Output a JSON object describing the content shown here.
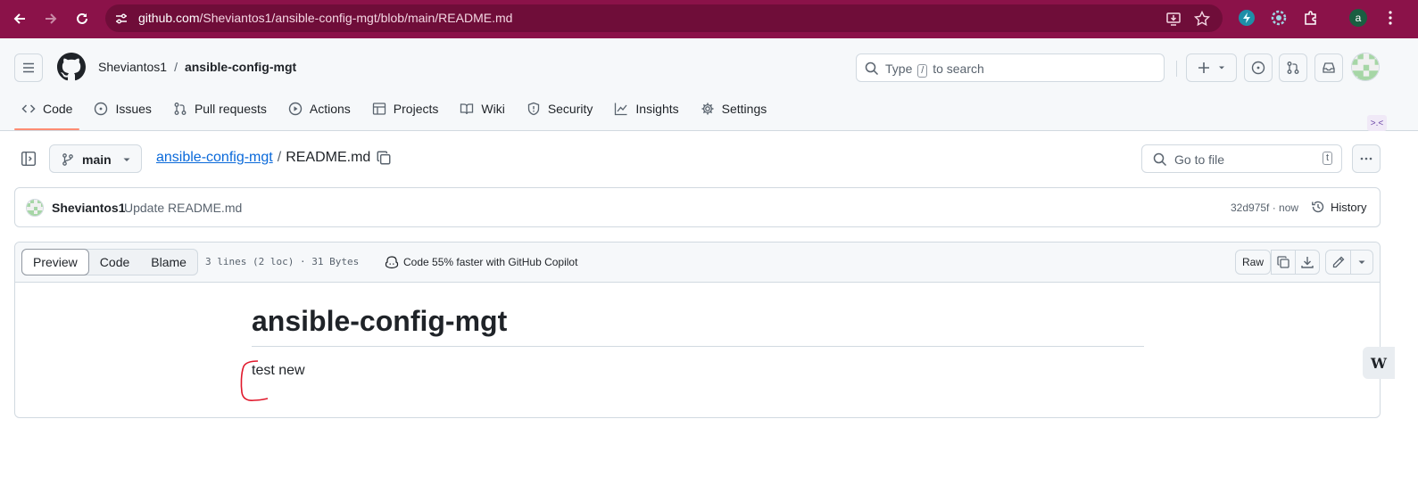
{
  "browser": {
    "url_host": "github.com",
    "url_path": "/Sheviantos1/ansible-config-mgt/blob/main/README.md",
    "profile_initial": "a",
    "chrome_color": "#8b1249"
  },
  "header": {
    "owner": "Sheviantos1",
    "separator": "/",
    "repo": "ansible-config-mgt",
    "search_prefix": "Type",
    "search_key": "/",
    "search_suffix": "to search"
  },
  "tabs": [
    {
      "label": "Code",
      "icon": "code-icon",
      "active": true
    },
    {
      "label": "Issues",
      "icon": "issue-icon"
    },
    {
      "label": "Pull requests",
      "icon": "pull-request-icon"
    },
    {
      "label": "Actions",
      "icon": "play-icon"
    },
    {
      "label": "Projects",
      "icon": "table-icon"
    },
    {
      "label": "Wiki",
      "icon": "book-icon"
    },
    {
      "label": "Security",
      "icon": "shield-icon"
    },
    {
      "label": "Insights",
      "icon": "graph-icon"
    },
    {
      "label": "Settings",
      "icon": "gear-icon"
    }
  ],
  "file_nav": {
    "branch": "main",
    "repo_link": "ansible-config-mgt",
    "path_sep": "/",
    "file_name": "README.md",
    "go_to_file": "Go to file",
    "go_to_file_key": "t"
  },
  "commit": {
    "author": "Sheviantos1",
    "message": "Update README.md",
    "sha_time": "32d975f · now",
    "history_label": "History"
  },
  "file": {
    "views": [
      "Preview",
      "Code",
      "Blame"
    ],
    "selected_view": "Preview",
    "line_info": "3 lines (2 loc) · 31 Bytes",
    "copilot_text": "Code 55% faster with GitHub Copilot",
    "raw_label": "Raw"
  },
  "readme": {
    "heading": "ansible-config-mgt",
    "body": "test new"
  },
  "floats": {
    "side_badge": ">.<",
    "w_badge": "W"
  }
}
